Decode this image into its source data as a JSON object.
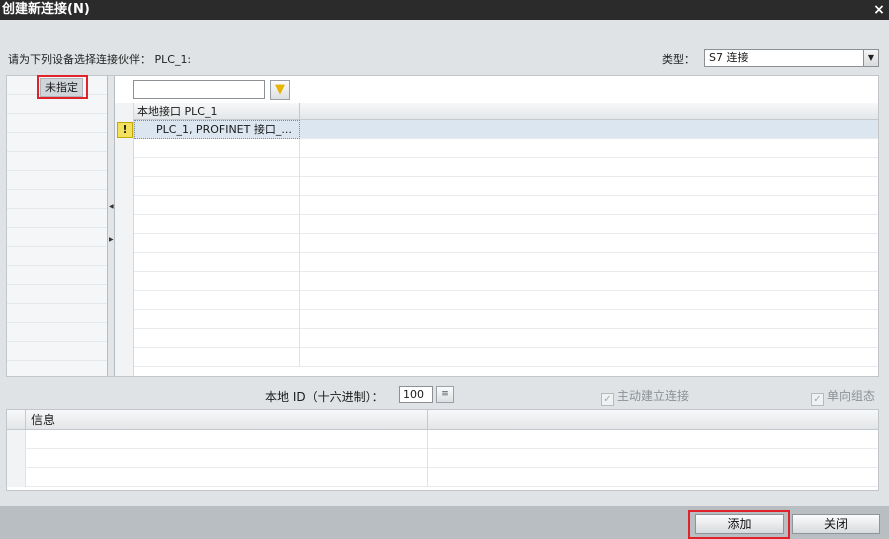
{
  "window": {
    "title": "创建新连接(N)",
    "close_glyph": "×"
  },
  "header": {
    "prompt": "请为下列设备选择连接伙伴： PLC_1:",
    "type_label": "类型：",
    "type_value": "S7 连接"
  },
  "tree": {
    "selected_item": "未指定"
  },
  "grid": {
    "column_header": "本地接口 PLC_1",
    "rows": [
      {
        "text": "PLC_1, PROFINET 接口_...",
        "warning": true
      }
    ]
  },
  "options": {
    "local_id_label": "本地 ID（十六进制）：",
    "local_id_value": "100",
    "active_connection_label": "主动建立连接",
    "one_way_label": "单向组态"
  },
  "info": {
    "column_header": "信息"
  },
  "buttons": {
    "add": "添加",
    "close": "关闭"
  }
}
